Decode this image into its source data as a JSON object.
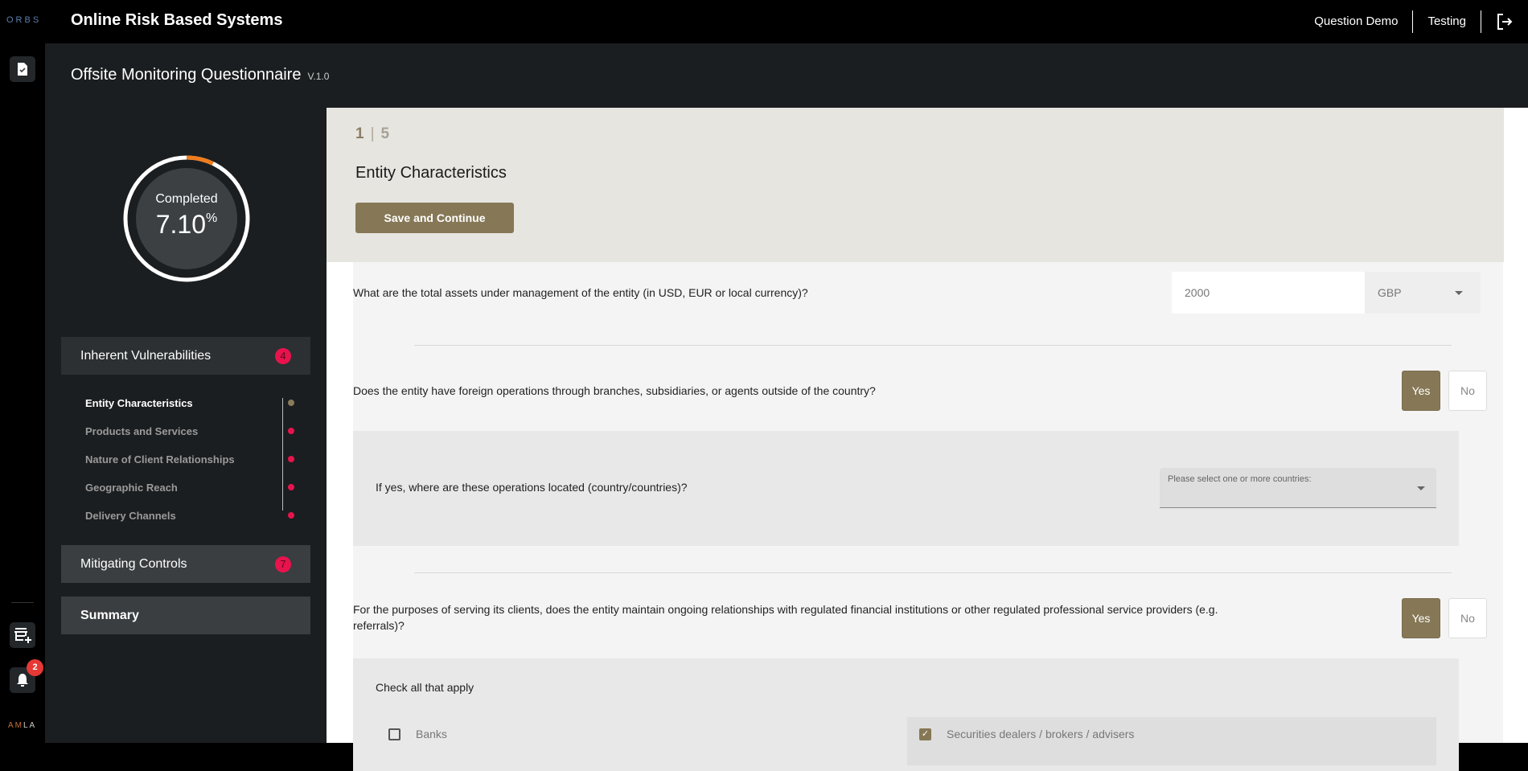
{
  "header": {
    "logo": "ORBS",
    "app_title": "Online Risk Based Systems",
    "links": [
      "Question Demo",
      "Testing"
    ],
    "logout_icon": "logout-icon"
  },
  "rail": {
    "icons": [
      "questionnaire-check-icon",
      "add-store-icon",
      "bell-icon"
    ],
    "notification_count": "2",
    "footer_logo_a": "AM",
    "footer_logo_b": "LA"
  },
  "questionnaire": {
    "title": "Offsite Monitoring Questionnaire",
    "version": "V.1.0",
    "progress": {
      "label": "Completed",
      "value": "7.10",
      "unit": "%",
      "fraction": 0.071,
      "accent": "#f07c1c"
    }
  },
  "nav": {
    "sections": [
      {
        "label": "Inherent Vulnerabilities",
        "badge": "4",
        "expanded": true
      },
      {
        "label": "Mitigating Controls",
        "badge": "7"
      },
      {
        "label": "Summary"
      }
    ],
    "subitems": [
      {
        "label": "Entity Characteristics",
        "active": true
      },
      {
        "label": "Products and Services"
      },
      {
        "label": "Nature of Client Relationships"
      },
      {
        "label": "Geographic Reach"
      },
      {
        "label": "Delivery Channels"
      }
    ]
  },
  "main": {
    "step_current": "1",
    "step_sep": "|",
    "step_total": "5",
    "section_title": "Entity Characteristics",
    "save_label": "Save and Continue",
    "accent": "#867856",
    "questions": [
      {
        "text": "What are the total assets under management of the entity (in USD, EUR or local currency)?",
        "input_value": "2000",
        "currency": "GBP"
      },
      {
        "text": "Does the entity have foreign operations through branches, subsidiaries, or agents outside of the country?",
        "yes": "Yes",
        "no": "No",
        "selected": "Yes",
        "followup": {
          "text": "If yes, where are these operations located (country/countries)?",
          "placeholder": "Please select one or more countries:"
        }
      },
      {
        "text": "For the purposes of serving its clients, does the entity maintain ongoing relationships with regulated financial institutions or other regulated professional service providers (e.g. referrals)?",
        "yes": "Yes",
        "no": "No",
        "selected": "Yes",
        "followup": {
          "text": "Check all that apply",
          "options": [
            {
              "label": "Banks",
              "checked": false
            },
            {
              "label": "Securities dealers / brokers / advisers",
              "checked": true
            }
          ]
        }
      }
    ]
  }
}
